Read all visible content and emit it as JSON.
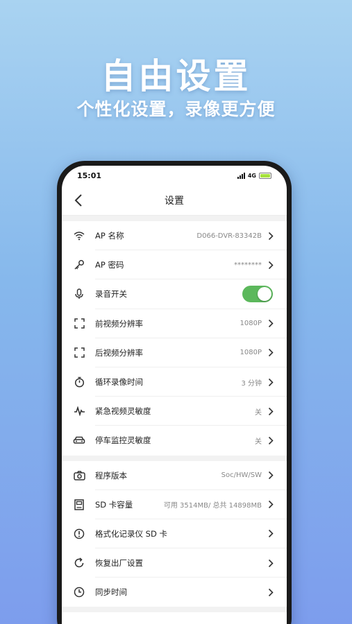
{
  "hero": {
    "title": "自由设置",
    "subtitle": "个性化设置，录像更方便"
  },
  "status_bar": {
    "time": "15:01",
    "network": "4G"
  },
  "nav": {
    "title": "设置"
  },
  "group1": [
    {
      "icon": "wifi-icon",
      "label": "AP 名称",
      "value": "D066-DVR-83342B"
    },
    {
      "icon": "key-icon",
      "label": "AP 密码",
      "value": "********"
    },
    {
      "icon": "microphone-icon",
      "label": "录音开关",
      "toggle": true
    },
    {
      "icon": "frame-icon",
      "label": "前视频分辨率",
      "value": "1080P"
    },
    {
      "icon": "frame-icon",
      "label": "后视频分辨率",
      "value": "1080P"
    },
    {
      "icon": "timer-icon",
      "label": "循环录像时间",
      "value": "3 分钟"
    },
    {
      "icon": "pulse-icon",
      "label": "紧急视频灵敏度",
      "value": "关"
    },
    {
      "icon": "car-icon",
      "label": "停车监控灵敏度",
      "value": "关"
    }
  ],
  "group2": [
    {
      "icon": "camera-icon",
      "label": "程序版本",
      "value": "Soc/HW/SW"
    },
    {
      "icon": "sd-card-icon",
      "label": "SD 卡容量",
      "value": "可用 3514MB/ 总共 14898MB"
    },
    {
      "icon": "alert-icon",
      "label": "格式化记录仪 SD 卡",
      "value": ""
    },
    {
      "icon": "refresh-icon",
      "label": "恢复出厂设置",
      "value": ""
    },
    {
      "icon": "clock-icon",
      "label": "同步时间",
      "value": ""
    }
  ],
  "colors": {
    "toggle_on": "#5cb85c",
    "battery": "#a6e23c"
  }
}
